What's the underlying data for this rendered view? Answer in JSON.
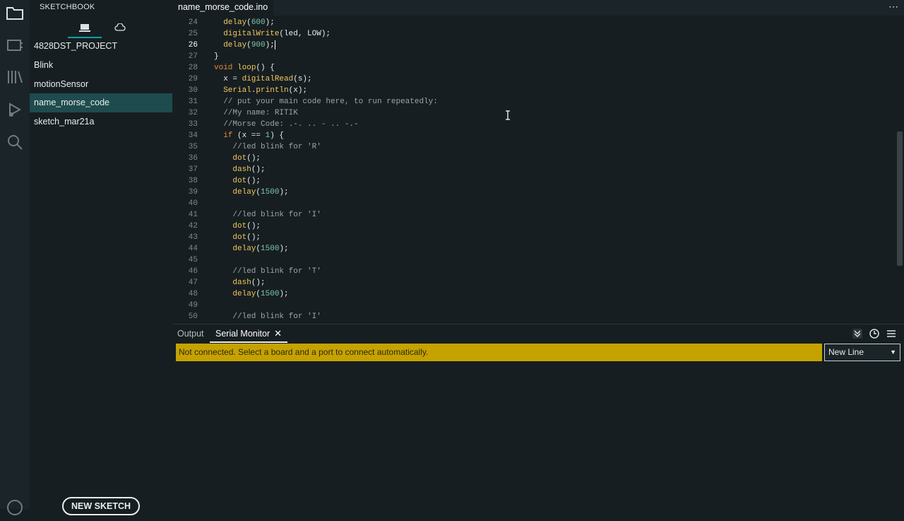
{
  "sidebar": {
    "title": "SKETCHBOOK",
    "sketches": [
      {
        "label": "4828DST_PROJECT",
        "selected": false
      },
      {
        "label": "Blink",
        "selected": false
      },
      {
        "label": "motionSensor",
        "selected": false
      },
      {
        "label": "name_morse_code",
        "selected": true
      },
      {
        "label": "sketch_mar21a",
        "selected": false
      }
    ],
    "new_sketch_label": "NEW SKETCH"
  },
  "editor": {
    "file_tab": "name_morse_code.ino",
    "more_menu": "⋯",
    "current_line": 26,
    "lines": [
      {
        "n": 24,
        "tokens": [
          [
            "pl",
            "  "
          ],
          [
            "f",
            "delay"
          ],
          [
            "pl",
            "("
          ],
          [
            "num",
            "600"
          ],
          [
            "pl",
            ");"
          ]
        ]
      },
      {
        "n": 25,
        "tokens": [
          [
            "pl",
            "  "
          ],
          [
            "f",
            "digitalWrite"
          ],
          [
            "pl",
            "(led, LOW);"
          ]
        ]
      },
      {
        "n": 26,
        "tokens": [
          [
            "pl",
            "  "
          ],
          [
            "f",
            "delay"
          ],
          [
            "pl",
            "("
          ],
          [
            "num",
            "900"
          ],
          [
            "pl",
            ");"
          ]
        ]
      },
      {
        "n": 27,
        "tokens": [
          [
            "pl",
            "}"
          ]
        ]
      },
      {
        "n": 28,
        "tokens": [
          [
            "k",
            "void"
          ],
          [
            "pl",
            " "
          ],
          [
            "f",
            "loop"
          ],
          [
            "pl",
            "() {"
          ]
        ]
      },
      {
        "n": 29,
        "tokens": [
          [
            "pl",
            "  x = "
          ],
          [
            "f",
            "digitalRead"
          ],
          [
            "pl",
            "(s);"
          ]
        ]
      },
      {
        "n": 30,
        "tokens": [
          [
            "pl",
            "  "
          ],
          [
            "f",
            "Serial"
          ],
          [
            "pl",
            "."
          ],
          [
            "f",
            "println"
          ],
          [
            "pl",
            "(x);"
          ]
        ]
      },
      {
        "n": 31,
        "tokens": [
          [
            "cm",
            "  // put your main code here, to run repeatedly:"
          ]
        ]
      },
      {
        "n": 32,
        "tokens": [
          [
            "cm",
            "  //My name: RITIK"
          ]
        ]
      },
      {
        "n": 33,
        "tokens": [
          [
            "cm",
            "  //Morse Code: .-. .. - .. -.-"
          ]
        ]
      },
      {
        "n": 34,
        "tokens": [
          [
            "pl",
            "  "
          ],
          [
            "k",
            "if"
          ],
          [
            "pl",
            " (x == "
          ],
          [
            "num",
            "1"
          ],
          [
            "pl",
            ") {"
          ]
        ]
      },
      {
        "n": 35,
        "tokens": [
          [
            "cm",
            "    //led blink for 'R'"
          ]
        ]
      },
      {
        "n": 36,
        "tokens": [
          [
            "pl",
            "    "
          ],
          [
            "f",
            "dot"
          ],
          [
            "pl",
            "();"
          ]
        ]
      },
      {
        "n": 37,
        "tokens": [
          [
            "pl",
            "    "
          ],
          [
            "f",
            "dash"
          ],
          [
            "pl",
            "();"
          ]
        ]
      },
      {
        "n": 38,
        "tokens": [
          [
            "pl",
            "    "
          ],
          [
            "f",
            "dot"
          ],
          [
            "pl",
            "();"
          ]
        ]
      },
      {
        "n": 39,
        "tokens": [
          [
            "pl",
            "    "
          ],
          [
            "f",
            "delay"
          ],
          [
            "pl",
            "("
          ],
          [
            "num",
            "1500"
          ],
          [
            "pl",
            ");"
          ]
        ]
      },
      {
        "n": 40,
        "tokens": []
      },
      {
        "n": 41,
        "tokens": [
          [
            "cm",
            "    //led blink for 'I'"
          ]
        ]
      },
      {
        "n": 42,
        "tokens": [
          [
            "pl",
            "    "
          ],
          [
            "f",
            "dot"
          ],
          [
            "pl",
            "();"
          ]
        ]
      },
      {
        "n": 43,
        "tokens": [
          [
            "pl",
            "    "
          ],
          [
            "f",
            "dot"
          ],
          [
            "pl",
            "();"
          ]
        ]
      },
      {
        "n": 44,
        "tokens": [
          [
            "pl",
            "    "
          ],
          [
            "f",
            "delay"
          ],
          [
            "pl",
            "("
          ],
          [
            "num",
            "1500"
          ],
          [
            "pl",
            ");"
          ]
        ]
      },
      {
        "n": 45,
        "tokens": []
      },
      {
        "n": 46,
        "tokens": [
          [
            "cm",
            "    //led blink for 'T'"
          ]
        ]
      },
      {
        "n": 47,
        "tokens": [
          [
            "pl",
            "    "
          ],
          [
            "f",
            "dash"
          ],
          [
            "pl",
            "();"
          ]
        ]
      },
      {
        "n": 48,
        "tokens": [
          [
            "pl",
            "    "
          ],
          [
            "f",
            "delay"
          ],
          [
            "pl",
            "("
          ],
          [
            "num",
            "1500"
          ],
          [
            "pl",
            ");"
          ]
        ]
      },
      {
        "n": 49,
        "tokens": []
      },
      {
        "n": 50,
        "tokens": [
          [
            "cm",
            "    //led blink for 'I'"
          ]
        ]
      }
    ]
  },
  "panel": {
    "tab_output": "Output",
    "tab_serial": "Serial Monitor",
    "close_glyph": "✕",
    "status_message": "Not connected. Select a board and a port to connect automatically.",
    "line_ending": "New Line",
    "line_ending_caret": "▼"
  },
  "colors": {
    "background": "#171e21",
    "accent": "#0ca1a6",
    "selected_item": "#1e4b4d",
    "warning": "#c5a200"
  },
  "icons": [
    "folder-icon",
    "boards-icon",
    "library-icon",
    "debug-icon",
    "search-icon",
    "account-icon",
    "laptop-icon",
    "cloud-icon",
    "toggle-autoscroll-icon",
    "timestamp-icon",
    "clear-output-icon"
  ]
}
